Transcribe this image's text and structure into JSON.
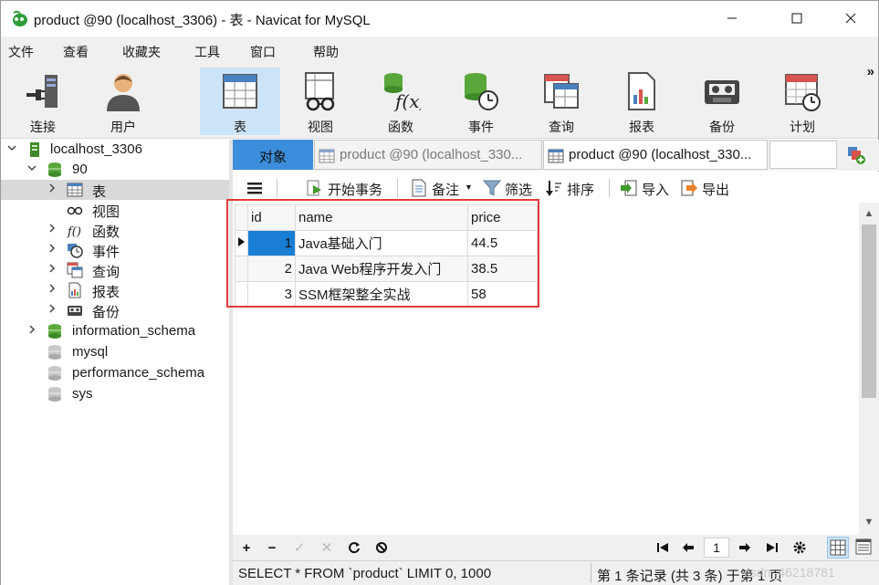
{
  "window": {
    "title": "product @90 (localhost_3306) - 表 - Navicat for MySQL",
    "controls": [
      "minimize",
      "maximize",
      "close"
    ]
  },
  "menu": [
    "文件",
    "查看",
    "收藏夹",
    "工具",
    "窗口",
    "帮助"
  ],
  "toolbar": {
    "items": [
      {
        "label": "连接",
        "icon": "connection-icon"
      },
      {
        "label": "用户",
        "icon": "user-icon"
      },
      {
        "label": "表",
        "icon": "table-icon",
        "active": true
      },
      {
        "label": "视图",
        "icon": "view-icon"
      },
      {
        "label": "函数",
        "icon": "function-icon"
      },
      {
        "label": "事件",
        "icon": "event-icon"
      },
      {
        "label": "查询",
        "icon": "query-icon"
      },
      {
        "label": "报表",
        "icon": "report-icon"
      },
      {
        "label": "备份",
        "icon": "backup-icon"
      },
      {
        "label": "计划",
        "icon": "schedule-icon"
      }
    ],
    "more": "»"
  },
  "tree": {
    "items": [
      {
        "label": "localhost_3306",
        "icon": "server-icon",
        "expanded": true
      },
      {
        "label": "90",
        "icon": "database-icon",
        "expanded": true
      },
      {
        "label": "表",
        "icon": "table-icon",
        "selected": true
      },
      {
        "label": "视图",
        "icon": "view-icon"
      },
      {
        "label": "函数",
        "icon": "function-icon"
      },
      {
        "label": "事件",
        "icon": "event-icon"
      },
      {
        "label": "查询",
        "icon": "query-icon"
      },
      {
        "label": "报表",
        "icon": "report-icon"
      },
      {
        "label": "备份",
        "icon": "backup-icon"
      },
      {
        "label": "information_schema",
        "icon": "database-icon"
      },
      {
        "label": "mysql",
        "icon": "database-icon"
      },
      {
        "label": "performance_schema",
        "icon": "database-icon"
      },
      {
        "label": "sys",
        "icon": "database-icon"
      }
    ]
  },
  "tabs": [
    {
      "label": "对象"
    },
    {
      "label": "product @90 (localhost_330..."
    },
    {
      "label": "product @90 (localhost_330..."
    }
  ],
  "object_toolbar": {
    "begin_transaction": "开始事务",
    "note": "备注",
    "filter": "筛选",
    "sort": "排序",
    "import": "导入",
    "export": "导出"
  },
  "grid": {
    "columns": [
      "id",
      "name",
      "price"
    ],
    "rows": [
      {
        "id": "1",
        "name": "Java基础入门",
        "price": "44.5"
      },
      {
        "id": "2",
        "name": "Java Web程序开发入门",
        "price": "38.5"
      },
      {
        "id": "3",
        "name": "SSM框架整全实战",
        "price": "58"
      }
    ]
  },
  "nav": {
    "page": "1"
  },
  "status": {
    "sql": "SELECT * FROM `product` LIMIT 0, 1000",
    "records": "第 1 条记录 (共 3 条) 于第 1 页",
    "watermark": "csdn_46218781"
  },
  "colors": {
    "accent": "#3c8ddb",
    "selected_cell": "#1a7fd4",
    "highlight_box": "#e23b3b"
  }
}
